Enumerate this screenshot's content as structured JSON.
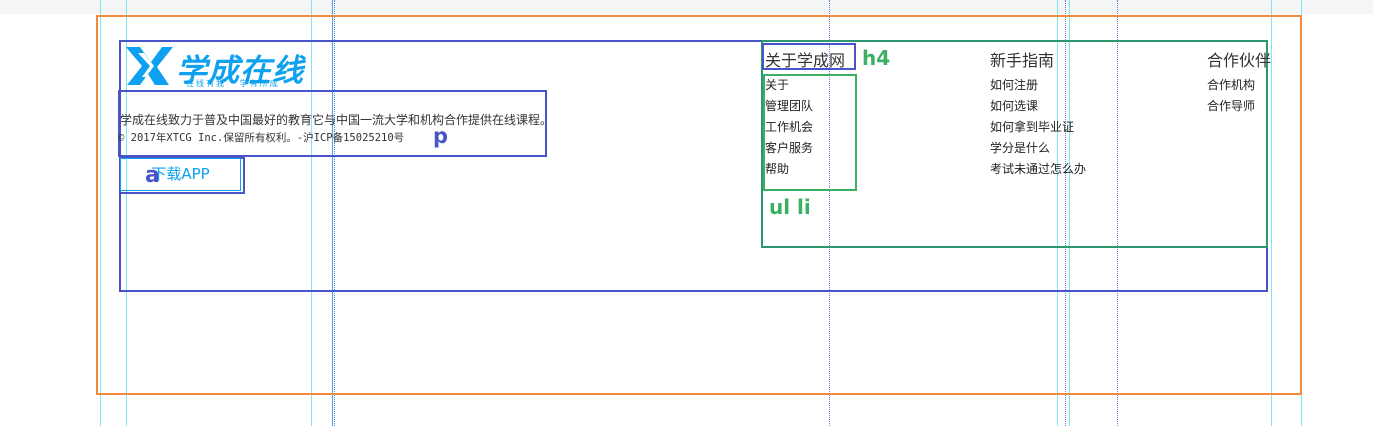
{
  "brand": {
    "logo_text": "学成在线",
    "logo_slogan": "在线有我 · 学有所成"
  },
  "about": {
    "intro": "学成在线致力于普及中国最好的教育它与中国一流大学和机构合作提供在线课程。",
    "copyright": "© 2017年XTCG Inc.保留所有权利。-沪ICP备15025210号",
    "app_label": "下载APP"
  },
  "columns": [
    {
      "title": "关于学成网",
      "items": [
        "关于",
        "管理团队",
        "工作机会",
        "客户服务",
        "帮助"
      ]
    },
    {
      "title": "新手指南",
      "items": [
        "如何注册",
        "如何选课",
        "如何拿到毕业证",
        "学分是什么",
        "考试未通过怎么办"
      ]
    },
    {
      "title": "合作伙伴",
      "items": [
        "合作机构",
        "合作导师"
      ]
    }
  ],
  "annotations": {
    "p": "p",
    "a": "a",
    "h4": "h4",
    "ul_li": "ul li"
  },
  "colors": {
    "brand": "#0ea1f0",
    "outline_orange": "#f08a3c",
    "outline_navy": "#4954c9",
    "outline_green": "#3bb062"
  }
}
